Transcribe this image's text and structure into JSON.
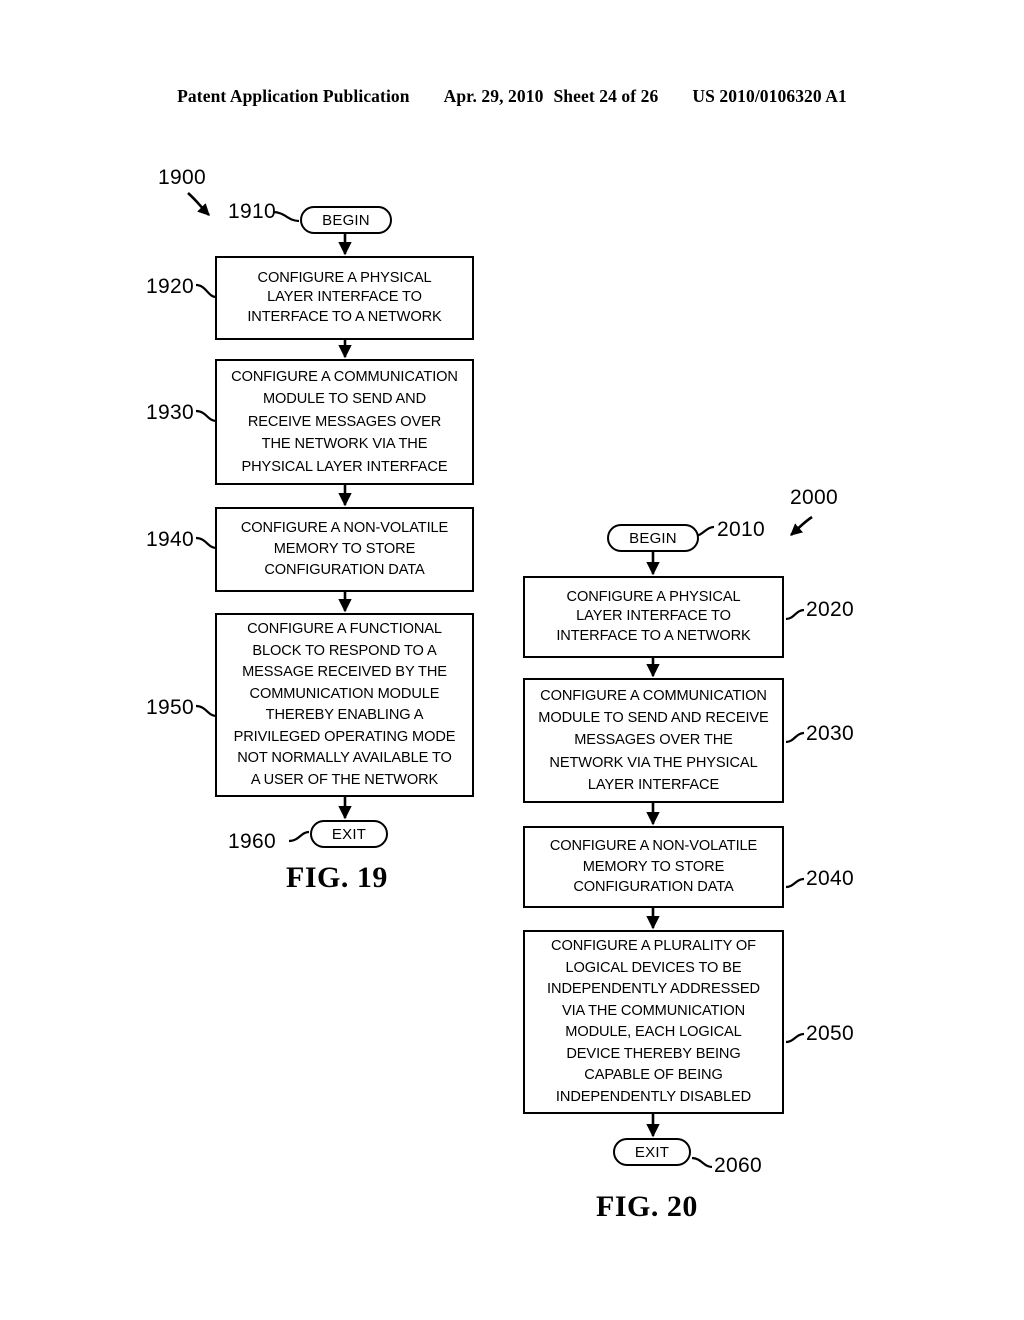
{
  "header": {
    "publication": "Patent Application Publication",
    "date": "Apr. 29, 2010",
    "sheet": "Sheet 24 of 26",
    "patent_number": "US 2010/0106320 A1"
  },
  "figures": [
    {
      "id": "fig19",
      "caption": "FIG. 19",
      "flow_ref": "1900",
      "nodes": [
        {
          "ref": "1910",
          "type": "terminal",
          "label": "BEGIN"
        },
        {
          "ref": "1920",
          "type": "process",
          "label": "CONFIGURE A PHYSICAL\nLAYER INTERFACE TO\nINTERFACE TO A NETWORK"
        },
        {
          "ref": "1930",
          "type": "process",
          "label": "CONFIGURE A COMMUNICATION\nMODULE TO SEND AND\nRECEIVE MESSAGES OVER\nTHE NETWORK VIA THE\nPHYSICAL LAYER INTERFACE"
        },
        {
          "ref": "1940",
          "type": "process",
          "label": "CONFIGURE A NON-VOLATILE\nMEMORY TO STORE\nCONFIGURATION DATA"
        },
        {
          "ref": "1950",
          "type": "process",
          "label": "CONFIGURE A FUNCTIONAL\nBLOCK TO RESPOND TO A\nMESSAGE RECEIVED BY THE\nCOMMUNICATION MODULE\nTHEREBY ENABLING A\nPRIVILEGED OPERATING MODE\nNOT NORMALLY AVAILABLE TO\nA USER OF THE NETWORK"
        },
        {
          "ref": "1960",
          "type": "terminal",
          "label": "EXIT"
        }
      ]
    },
    {
      "id": "fig20",
      "caption": "FIG. 20",
      "flow_ref": "2000",
      "nodes": [
        {
          "ref": "2010",
          "type": "terminal",
          "label": "BEGIN"
        },
        {
          "ref": "2020",
          "type": "process",
          "label": "CONFIGURE A PHYSICAL\nLAYER INTERFACE TO\nINTERFACE TO A NETWORK"
        },
        {
          "ref": "2030",
          "type": "process",
          "label": "CONFIGURE A COMMUNICATION\nMODULE TO SEND AND RECEIVE\nMESSAGES OVER THE\nNETWORK VIA THE PHYSICAL\nLAYER INTERFACE"
        },
        {
          "ref": "2040",
          "type": "process",
          "label": "CONFIGURE A NON-VOLATILE\nMEMORY TO STORE\nCONFIGURATION DATA"
        },
        {
          "ref": "2050",
          "type": "process",
          "label": "CONFIGURE A PLURALITY OF\nLOGICAL DEVICES TO BE\nINDEPENDENTLY ADDRESSED\nVIA THE COMMUNICATION\nMODULE, EACH LOGICAL\nDEVICE THEREBY BEING\nCAPABLE OF BEING\nINDEPENDENTLY DISABLED"
        },
        {
          "ref": "2060",
          "type": "terminal",
          "label": "EXIT"
        }
      ]
    }
  ],
  "colors": {
    "ink": "#000000",
    "paper": "#ffffff"
  }
}
